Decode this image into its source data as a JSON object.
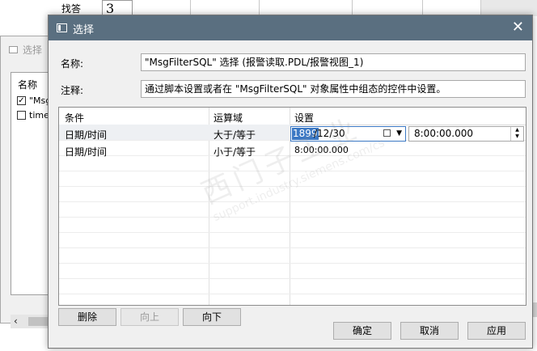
{
  "background": {
    "find_text": "找答",
    "cell_value": "3"
  },
  "back_dialog": {
    "title": "选择",
    "list_header": "名称",
    "items": [
      {
        "label": "\"Msg",
        "checked": true
      },
      {
        "label": "time",
        "checked": false
      }
    ]
  },
  "dialog": {
    "title": "选择",
    "name_label": "名称:",
    "name_value": "\"MsgFilterSQL\" 选择 (报警读取.PDL/报警视图_1)",
    "comment_label": "注释:",
    "comment_value": "通过脚本设置或者在 \"MsgFilterSQL\" 对象属性中组态的控件中设置。",
    "grid": {
      "headers": [
        "条件",
        "运算域",
        "设置"
      ],
      "rows": [
        {
          "condition": "日期/时间",
          "operator": "大于/等于",
          "date_selected": "1899",
          "date_rest": "/12/30",
          "time": "8:00:00.000"
        },
        {
          "condition": "日期/时间",
          "operator": "小于/等于",
          "setting": "8:00:00.000"
        }
      ]
    },
    "buttons": {
      "delete": "删除",
      "move_up": "向上",
      "move_down": "向下",
      "ok": "确定",
      "cancel": "取消",
      "apply": "应用"
    },
    "watermark": {
      "cn": "西门子工业",
      "en": "support.industry.siemens.com/cs"
    }
  },
  "colors": {
    "titlebar": "#5a6f80",
    "selection": "#3b78c4",
    "dialog_bg": "#f0f0f0"
  }
}
